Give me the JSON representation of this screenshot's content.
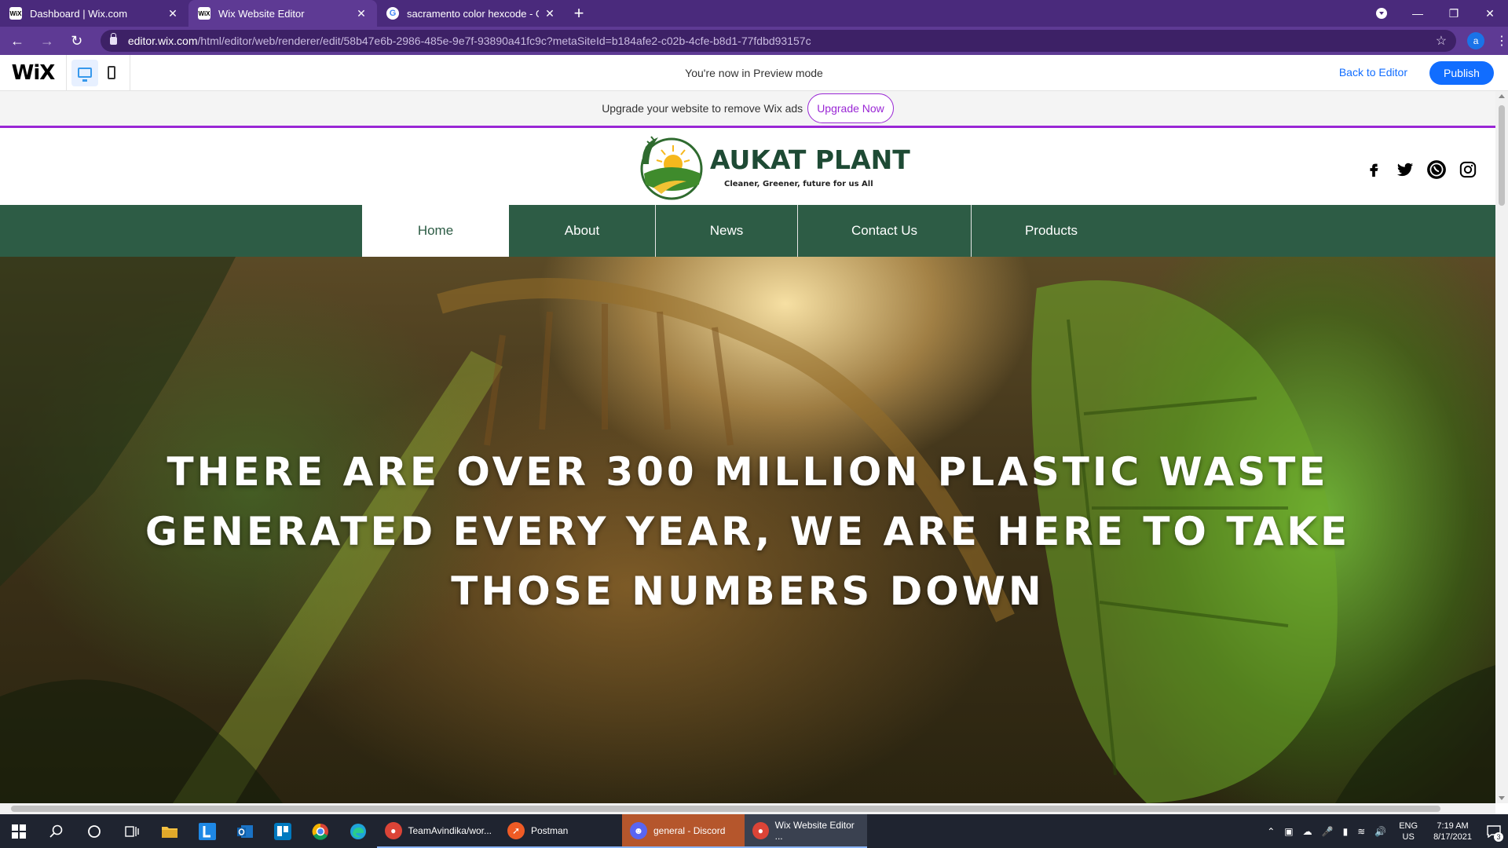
{
  "browser": {
    "tabs": [
      {
        "title": "Dashboard | Wix.com",
        "favicon": "WiX",
        "active": false
      },
      {
        "title": "Wix Website Editor",
        "favicon": "WiX",
        "active": true
      },
      {
        "title": "sacramento color hexcode - Goo",
        "favicon": "G",
        "active": false
      }
    ],
    "new_tab": "+",
    "close_glyph": "✕",
    "url_host": "editor.wix.com",
    "url_path": "/html/editor/web/renderer/edit/58b47e6b-2986-485e-9e7f-93890a41fc9c?metaSiteId=b184afe2-c02b-4cfe-b8d1-77fdbd93157c",
    "profile_initial": "a"
  },
  "wix_preview": {
    "logo": "WiX",
    "preview_message": "You're now in Preview mode",
    "back_to_editor": "Back to Editor",
    "publish": "Publish"
  },
  "upgrade_banner": {
    "message": "Upgrade your website to remove Wix ads",
    "button": "Upgrade Now"
  },
  "site": {
    "brand": "AUKAT PLANT",
    "tagline": "Cleaner, Greener, future for us All",
    "nav": [
      "Home",
      "About",
      "News",
      "Contact Us",
      "Products"
    ],
    "active_nav": "Home",
    "social_icons": [
      "facebook-icon",
      "twitter-icon",
      "whatsapp-icon",
      "instagram-icon"
    ],
    "hero_text": "THERE ARE OVER 300 MILLION PLASTIC WASTE GENERATED EVERY YEAR, WE ARE HERE TO TAKE THOSE NUMBERS DOWN",
    "brand_color": "#2d5c45"
  },
  "taskbar": {
    "apps": [
      {
        "label": "TeamAvindika/wor...",
        "icon": "chrome-icon",
        "color": "#db4437"
      },
      {
        "label": "Postman",
        "icon": "postman-icon",
        "color": "#ef5b25"
      },
      {
        "label": "general - Discord",
        "icon": "discord-icon",
        "color": "#5865f2"
      },
      {
        "label": "Wix Website Editor ...",
        "icon": "chrome-icon",
        "color": "#db4437"
      }
    ],
    "lang_top": "ENG",
    "lang_bottom": "US",
    "time": "7:19 AM",
    "date": "8/17/2021",
    "notification_count": "3"
  }
}
